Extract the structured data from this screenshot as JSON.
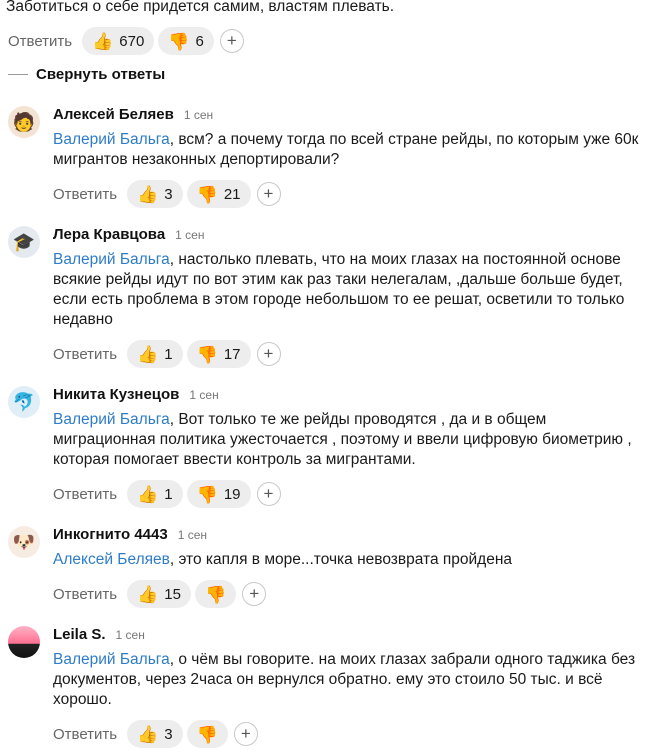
{
  "top": {
    "text": "Заботиться о себе придется самим, властям плевать.",
    "reply_label": "Ответить",
    "likes": "670",
    "dislikes": "6",
    "plus": "+"
  },
  "thread": {
    "collapse_label": "Свернуть ответы"
  },
  "icons": {
    "like": "👍",
    "dislike": "👍",
    "plus": "+"
  },
  "comments": [
    {
      "author": "Алексей Беляев",
      "time": "1 сен",
      "avatar": "🧑",
      "avatar_bg": "#f3e3d3",
      "mention": "Валерий Бальга",
      "text": ", всм? а почему тогда по всей стране рейды, по которым уже 60к мигрантов незаконных депортировали?",
      "reply_label": "Ответить",
      "likes": "3",
      "dislikes": "21"
    },
    {
      "author": "Лера Кравцова",
      "time": "1 сен",
      "avatar": "🎓",
      "avatar_bg": "#e4eaf0",
      "mention": "Валерий Бальга",
      "text": ", настолько плевать, что на моих глазах на постоянной основе всякие рейды идут по вот этим как раз таки нелегалам, ,дальше больше будет, если есть проблема в этом городе небольшом то ее решат, осветили то только недавно",
      "reply_label": "Ответить",
      "likes": "1",
      "dislikes": "17"
    },
    {
      "author": "Никита Кузнецов",
      "time": "1 сен",
      "avatar": "🐬",
      "avatar_bg": "#e0eef8",
      "mention": "Валерий Бальга",
      "text": ", Вот только те же рейды проводятся , да и в общем миграционная политика ужесточается , поэтому и ввели цифровую биометрию , которая помогает ввести контроль за мигрантами.",
      "reply_label": "Ответить",
      "likes": "1",
      "dislikes": "19"
    },
    {
      "author": "Инкогнито 4443",
      "time": "1 сен",
      "avatar": "🐶",
      "avatar_bg": "#f6ece2",
      "mention": "Алексей Беляев",
      "text": ", это капля в море...точка невозврата пройдена",
      "reply_label": "Ответить",
      "likes": "15",
      "dislikes": ""
    },
    {
      "author": "Leila S.",
      "time": "1 сен",
      "avatar": "",
      "avatar_bg": "linear-gradient(180deg,#ffb3c7 0%,#ff6f91 55%,#222 56%,#111 100%)",
      "mention": "Валерий Бальга",
      "text": ", о чём вы говорите. на моих глазах забрали одного таджика без документов, через 2часа он вернулся обратно. ему это стоило 50 тыс. и всё хорошо.",
      "reply_label": "Ответить",
      "likes": "3",
      "dislikes": ""
    }
  ]
}
